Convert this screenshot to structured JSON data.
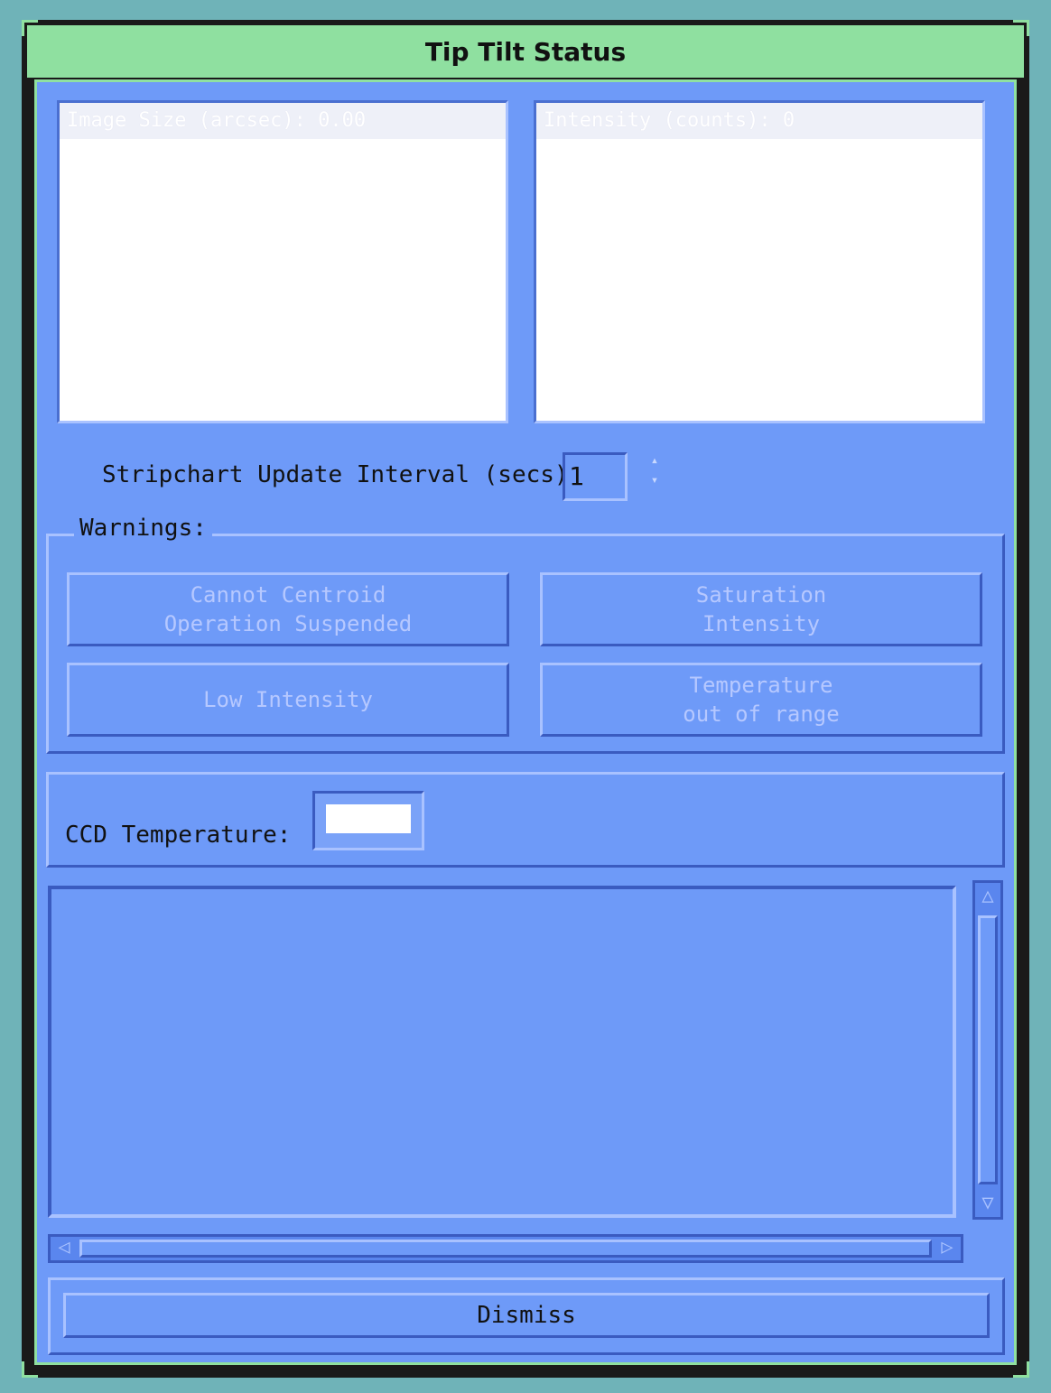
{
  "window": {
    "title": "Tip Tilt Status"
  },
  "lists": {
    "left_header": "Image Size (arcsec): 0.00",
    "right_header": "Intensity (counts): 0"
  },
  "stripchart": {
    "label": "Stripchart Update Interval (secs)",
    "value": "1"
  },
  "warnings": {
    "group_label": "Warnings:",
    "items": [
      {
        "label": "Cannot Centroid\nOperation Suspended"
      },
      {
        "label": "Saturation\nIntensity"
      },
      {
        "label": "Low Intensity"
      },
      {
        "label": "Temperature\nout of range"
      }
    ]
  },
  "ccd": {
    "label": "CCD Temperature:",
    "value": ""
  },
  "footer": {
    "dismiss_label": "Dismiss"
  },
  "colors": {
    "panel": "#6e9af8",
    "titlebar": "#8fe0a0",
    "desktop": "#6fb3b8"
  }
}
